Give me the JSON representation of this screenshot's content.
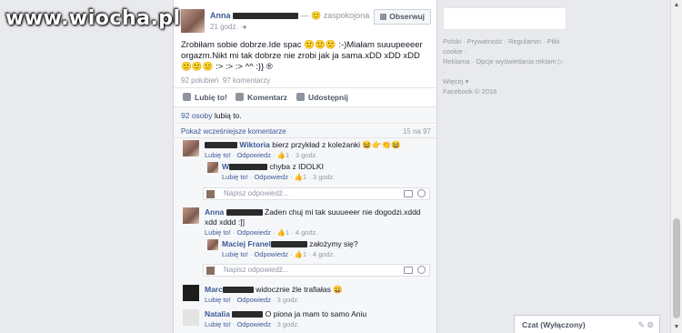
{
  "watermark": "www.wiocha.pl",
  "post": {
    "author": "Anna",
    "feeling": "— 🙂 zaspokojona",
    "time": "21 godz.",
    "follow_label": "Obserwuj",
    "text": "Zrobiłam sobie dobrze.Ide spac 🙂🙂🙂 :-)Miałam suuupeeeer orgazm.Nikt mi tak dobrze nie zrobi jak ja sama.xDD xDD xDD 🙂🙂🙂 :> :> :> ^^ :}} ®",
    "likes_count": "92 polubień",
    "comments_count": "97 komentarzy",
    "actions": {
      "like": "Lubię to!",
      "comment": "Komentarz",
      "share": "Udostępnij"
    },
    "likers_link": "92 osoby",
    "likers_suffix": "lubią to.",
    "show_previous": "Pokaż wcześniejsze komentarze",
    "shown_count": "15 na 97"
  },
  "comments": [
    {
      "name": "Wiktoria",
      "text": "bierz przykład z koleżanki 😆👉👏😆",
      "like": "Lubię to!",
      "reply": "Odpowiedz",
      "likes": "1",
      "time": "3 godz."
    },
    {
      "name": "W",
      "text": "chyba z IDOLKI",
      "like": "Lubię to!",
      "reply": "Odpowiedz",
      "likes": "1",
      "time": "3 godz."
    },
    {
      "name": "Anna",
      "text": "Żaden chuj mi tak suuueeer nie dogodzi.xddd xdd xddd :]]",
      "like": "Lubię to!",
      "reply": "Odpowiedz",
      "likes": "1",
      "time": "4 godz."
    },
    {
      "name": "Maciej Franel",
      "text": "założymy się?",
      "like": "Lubię to!",
      "reply": "Odpowiedz",
      "likes": "1",
      "time": "4 godz."
    },
    {
      "name": "Marc",
      "text": "widocznie źle trafiałas 😀",
      "like": "Lubię to!",
      "reply": "Odpowiedz",
      "time": "3 godz."
    },
    {
      "name": "Natalia",
      "text": "O piona ja mam to samo Aniu",
      "like": "Lubię to!",
      "reply": "Odpowiedz",
      "time": "3 godz."
    }
  ],
  "reply_placeholder": "Napisz odpowiedź...",
  "sidebar": {
    "footer_line1": "Polski · Prywatność · Regulamin · Pliki cookie ·",
    "footer_line2": "Reklama · Opcje wyświetlania reklam ▷ ·",
    "footer_line3": "Więcej ▾",
    "footer_line4": "Facebook © 2016"
  },
  "chat": {
    "label": "Czat (Wyłączony)"
  }
}
